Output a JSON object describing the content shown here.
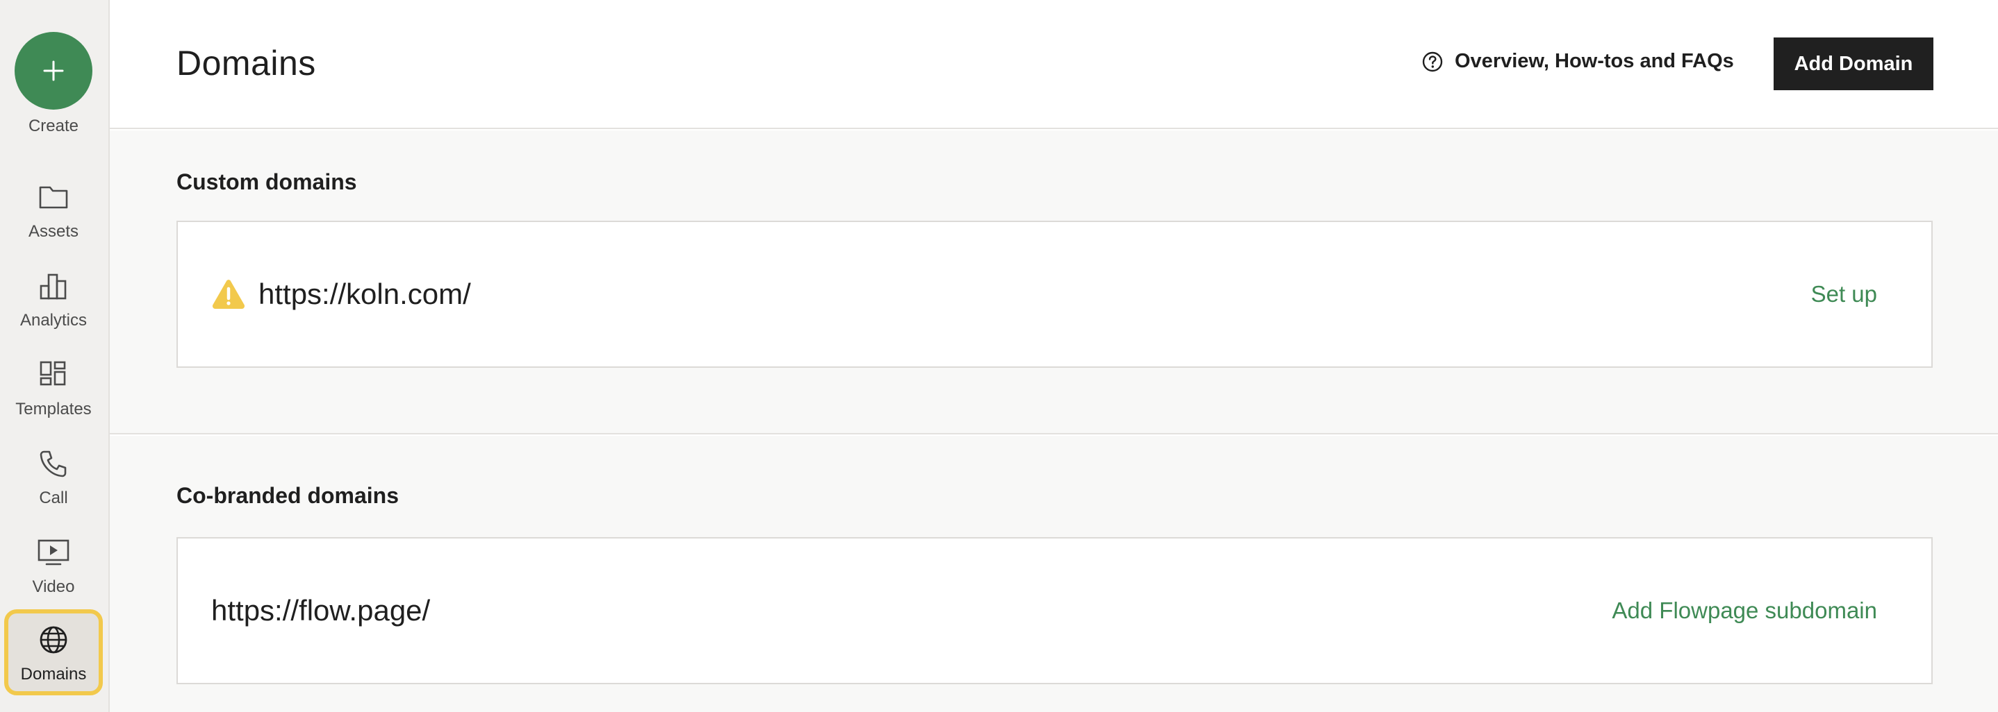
{
  "sidebar": {
    "create_label": "Create",
    "items": [
      {
        "label": "Assets",
        "icon": "folder-icon"
      },
      {
        "label": "Analytics",
        "icon": "bar-chart-icon"
      },
      {
        "label": "Templates",
        "icon": "grid-icon"
      },
      {
        "label": "Call",
        "icon": "phone-icon"
      },
      {
        "label": "Video",
        "icon": "video-icon"
      },
      {
        "label": "Domains",
        "icon": "globe-icon",
        "active": true
      }
    ]
  },
  "header": {
    "title": "Domains",
    "help_link": "Overview, How-tos and FAQs",
    "add_domain_label": "Add Domain"
  },
  "custom_domains": {
    "title": "Custom domains",
    "items": [
      {
        "url": "https://koln.com/",
        "status_icon": "warning-icon",
        "action": "Set up"
      }
    ]
  },
  "cobranded_domains": {
    "title": "Co-branded domains",
    "items": [
      {
        "url": "https://flow.page/",
        "action": "Add Flowpage subdomain"
      }
    ]
  },
  "colors": {
    "accent_green": "#3f8a55",
    "warning_yellow": "#f2c94c",
    "button_dark": "#202020"
  }
}
